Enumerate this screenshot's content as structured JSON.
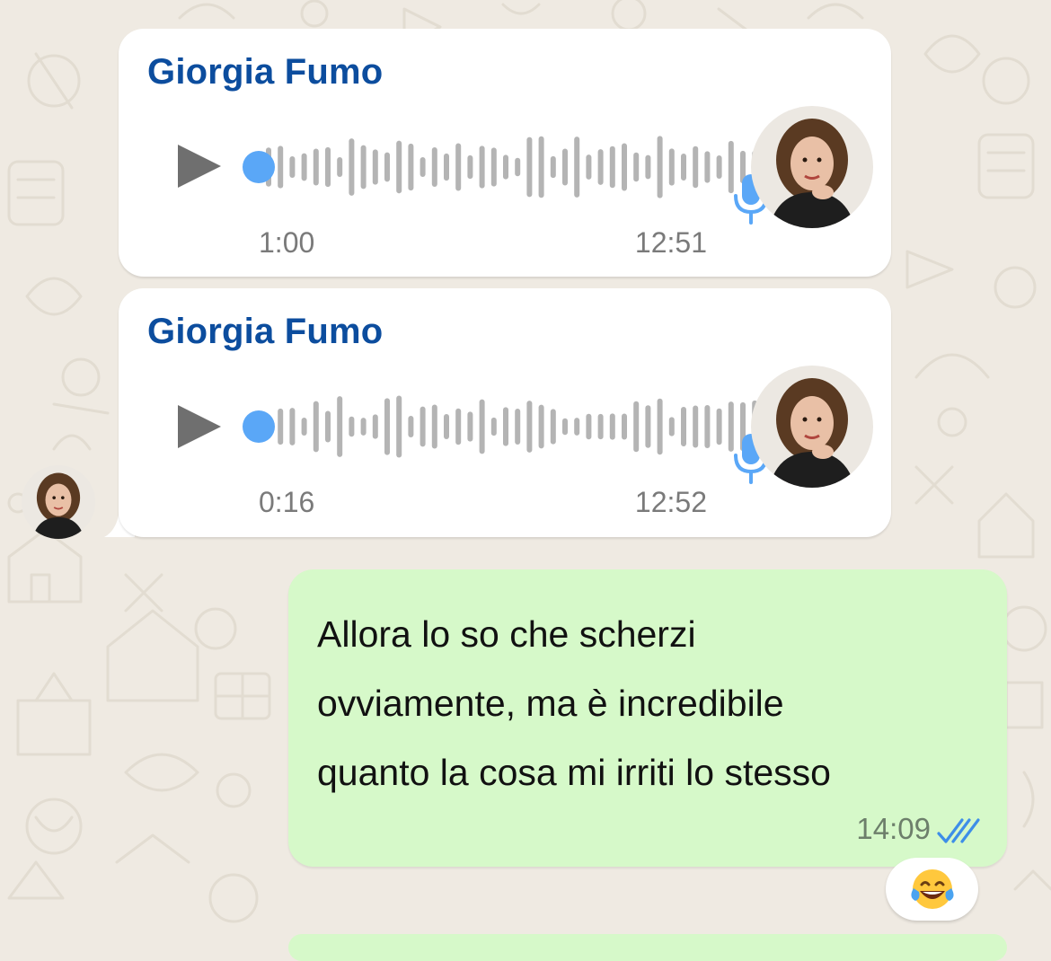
{
  "messages": [
    {
      "sender": "Giorgia Fumo",
      "duration": "1:00",
      "time": "12:51"
    },
    {
      "sender": "Giorgia Fumo",
      "duration": "0:16",
      "time": "12:52"
    }
  ],
  "outgoing": {
    "lines": [
      "Allora lo so che scherzi",
      "ovviamente, ma è incredibile",
      "quanto la cosa mi irriti lo stesso"
    ],
    "time": "14:09",
    "status": "read"
  },
  "reaction": {
    "emoji": "😂"
  },
  "icons": {
    "play": "play-icon",
    "mic": "microphone-icon",
    "ticks": "double-check-icon"
  },
  "colors": {
    "background": "#efeae2",
    "sender_name": "#0c4d9e",
    "progress_dot": "#5aa7f7",
    "mic": "#5aa7f7",
    "waveform": "#b4b4b4",
    "outgoing_bubble": "#d6f9c9",
    "read_ticks": "#3d8ee8"
  }
}
